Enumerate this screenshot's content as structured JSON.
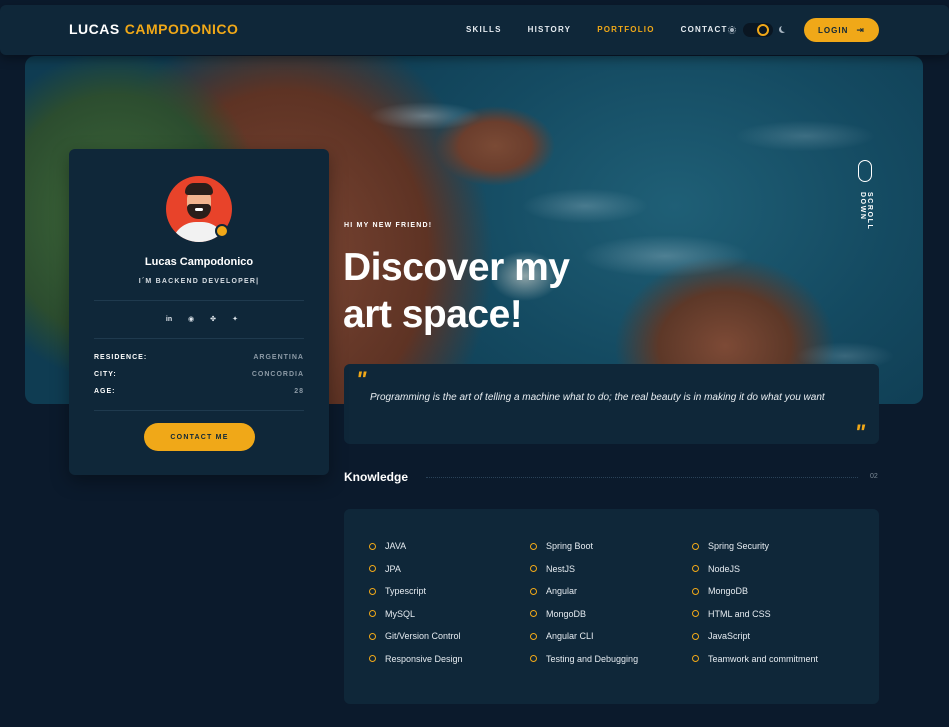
{
  "nav": {
    "logo_first": "LUCAS",
    "logo_last": "CAMPODONICO",
    "links": [
      {
        "label": "SKILLS"
      },
      {
        "label": "HISTORY"
      },
      {
        "label": "PORTFOLIO",
        "active": true
      },
      {
        "label": "CONTACT"
      }
    ],
    "login_label": "LOGIN",
    "theme": "dark"
  },
  "hero": {
    "greeting": "HI MY NEW FRIEND!",
    "headline_line1": "Discover my",
    "headline_line2": "art space!",
    "scroll_label": "SCROLL DOWN"
  },
  "profile": {
    "name": "Lucas Campodonico",
    "role": "I´M BACKEND DEVELOPER|",
    "socials": [
      "linkedin-icon",
      "github-icon",
      "gitlab-icon",
      "twitter-icon"
    ],
    "info": [
      {
        "key": "RESIDENCE:",
        "value": "ARGENTINA"
      },
      {
        "key": "CITY:",
        "value": "CONCORDIA"
      },
      {
        "key": "AGE:",
        "value": "28"
      }
    ],
    "contact_label": "CONTACT ME"
  },
  "quote": {
    "text": "Programming is the art of telling a machine what to do; the real beauty is in making it do what you want"
  },
  "knowledge": {
    "title": "Knowledge",
    "number": "02",
    "columns": [
      [
        "JAVA",
        "JPA",
        "Typescript",
        "MySQL",
        "Git/Version Control",
        "Responsive Design"
      ],
      [
        "Spring Boot",
        "NestJS",
        "Angular",
        "MongoDB",
        "Angular CLI",
        "Testing and Debugging"
      ],
      [
        "Spring Security",
        "NodeJS",
        "MongoDB",
        "HTML and CSS",
        "JavaScript",
        "Teamwork and commitment"
      ]
    ]
  },
  "colors": {
    "accent": "#f0a818",
    "background": "#0b1a2c",
    "card": "#0f2739"
  }
}
